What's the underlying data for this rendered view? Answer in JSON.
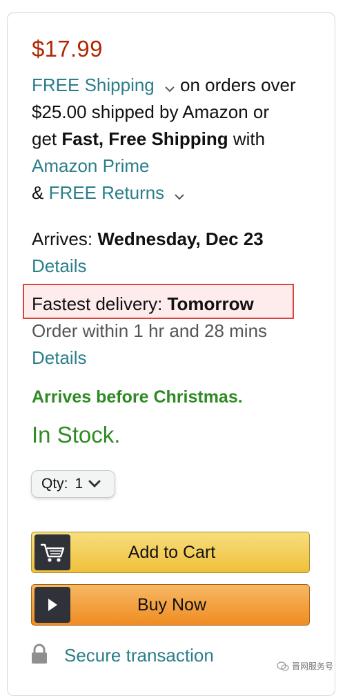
{
  "price": "$17.99",
  "shipping": {
    "free_shipping_link": "FREE Shipping",
    "line1_suffix": "on orders over",
    "line2": "$25.00 shipped by Amazon or",
    "line3_prefix": "get",
    "line3_bold": "Fast, Free Shipping",
    "line3_suffix": "with",
    "prime_link": "Amazon Prime",
    "returns_prefix": "&",
    "returns_link": "FREE Returns"
  },
  "delivery": {
    "arrives_label": "Arrives:",
    "arrives_date": "Wednesday, Dec 23",
    "details_link_1": "Details",
    "fastest_label": "Fastest delivery:",
    "fastest_value": "Tomorrow",
    "order_within": "Order within 1 hr and 28 mins",
    "details_link_2": "Details",
    "christmas_note": "Arrives before Christmas."
  },
  "stock_status": "In Stock.",
  "quantity": {
    "label": "Qty:",
    "value": "1"
  },
  "buttons": {
    "add_to_cart": "Add to Cart",
    "buy_now": "Buy Now"
  },
  "secure_transaction": "Secure transaction",
  "watermark": "晋网服务号",
  "colors": {
    "price": "#b12704",
    "link": "#2a7e8a",
    "in_stock": "#2f8a24",
    "highlight_border": "#d9453d",
    "add_to_cart": "#f0c03b",
    "buy_now": "#ef8d22"
  }
}
